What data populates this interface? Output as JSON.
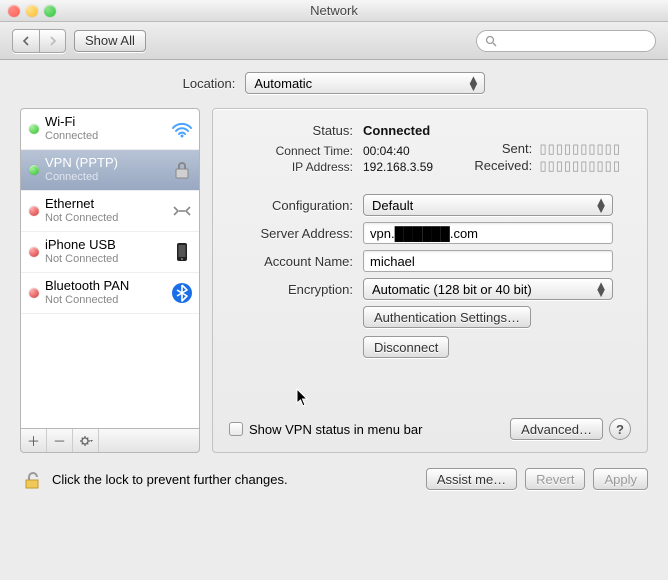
{
  "window": {
    "title": "Network"
  },
  "toolbar": {
    "show_all": "Show All",
    "search_placeholder": ""
  },
  "location": {
    "label": "Location:",
    "value": "Automatic"
  },
  "services": [
    {
      "name": "Wi-Fi",
      "status": "Connected",
      "dot": "green",
      "icon": "wifi",
      "selected": false
    },
    {
      "name": "VPN (PPTP)",
      "status": "Connected",
      "dot": "green",
      "icon": "lock",
      "selected": true
    },
    {
      "name": "Ethernet",
      "status": "Not Connected",
      "dot": "red",
      "icon": "ethernet",
      "selected": false
    },
    {
      "name": "iPhone USB",
      "status": "Not Connected",
      "dot": "red",
      "icon": "iphone",
      "selected": false
    },
    {
      "name": "Bluetooth PAN",
      "status": "Not Connected",
      "dot": "red",
      "icon": "bluetooth",
      "selected": false
    }
  ],
  "detail": {
    "status_label": "Status:",
    "status_value": "Connected",
    "connect_time_label": "Connect Time:",
    "connect_time_value": "00:04:40",
    "ip_label": "IP Address:",
    "ip_value": "192.168.3.59",
    "sent_label": "Sent:",
    "received_label": "Received:",
    "configuration_label": "Configuration:",
    "configuration_value": "Default",
    "server_label": "Server Address:",
    "server_value": "vpn.██████.com",
    "account_label": "Account Name:",
    "account_value": "michael",
    "encryption_label": "Encryption:",
    "encryption_value": "Automatic (128 bit or 40 bit)",
    "auth_button": "Authentication Settings…",
    "disconnect_button": "Disconnect",
    "show_menu_bar": "Show VPN status in menu bar",
    "advanced_button": "Advanced…"
  },
  "footer": {
    "lock_text": "Click the lock to prevent further changes.",
    "assist": "Assist me…",
    "revert": "Revert",
    "apply": "Apply"
  }
}
